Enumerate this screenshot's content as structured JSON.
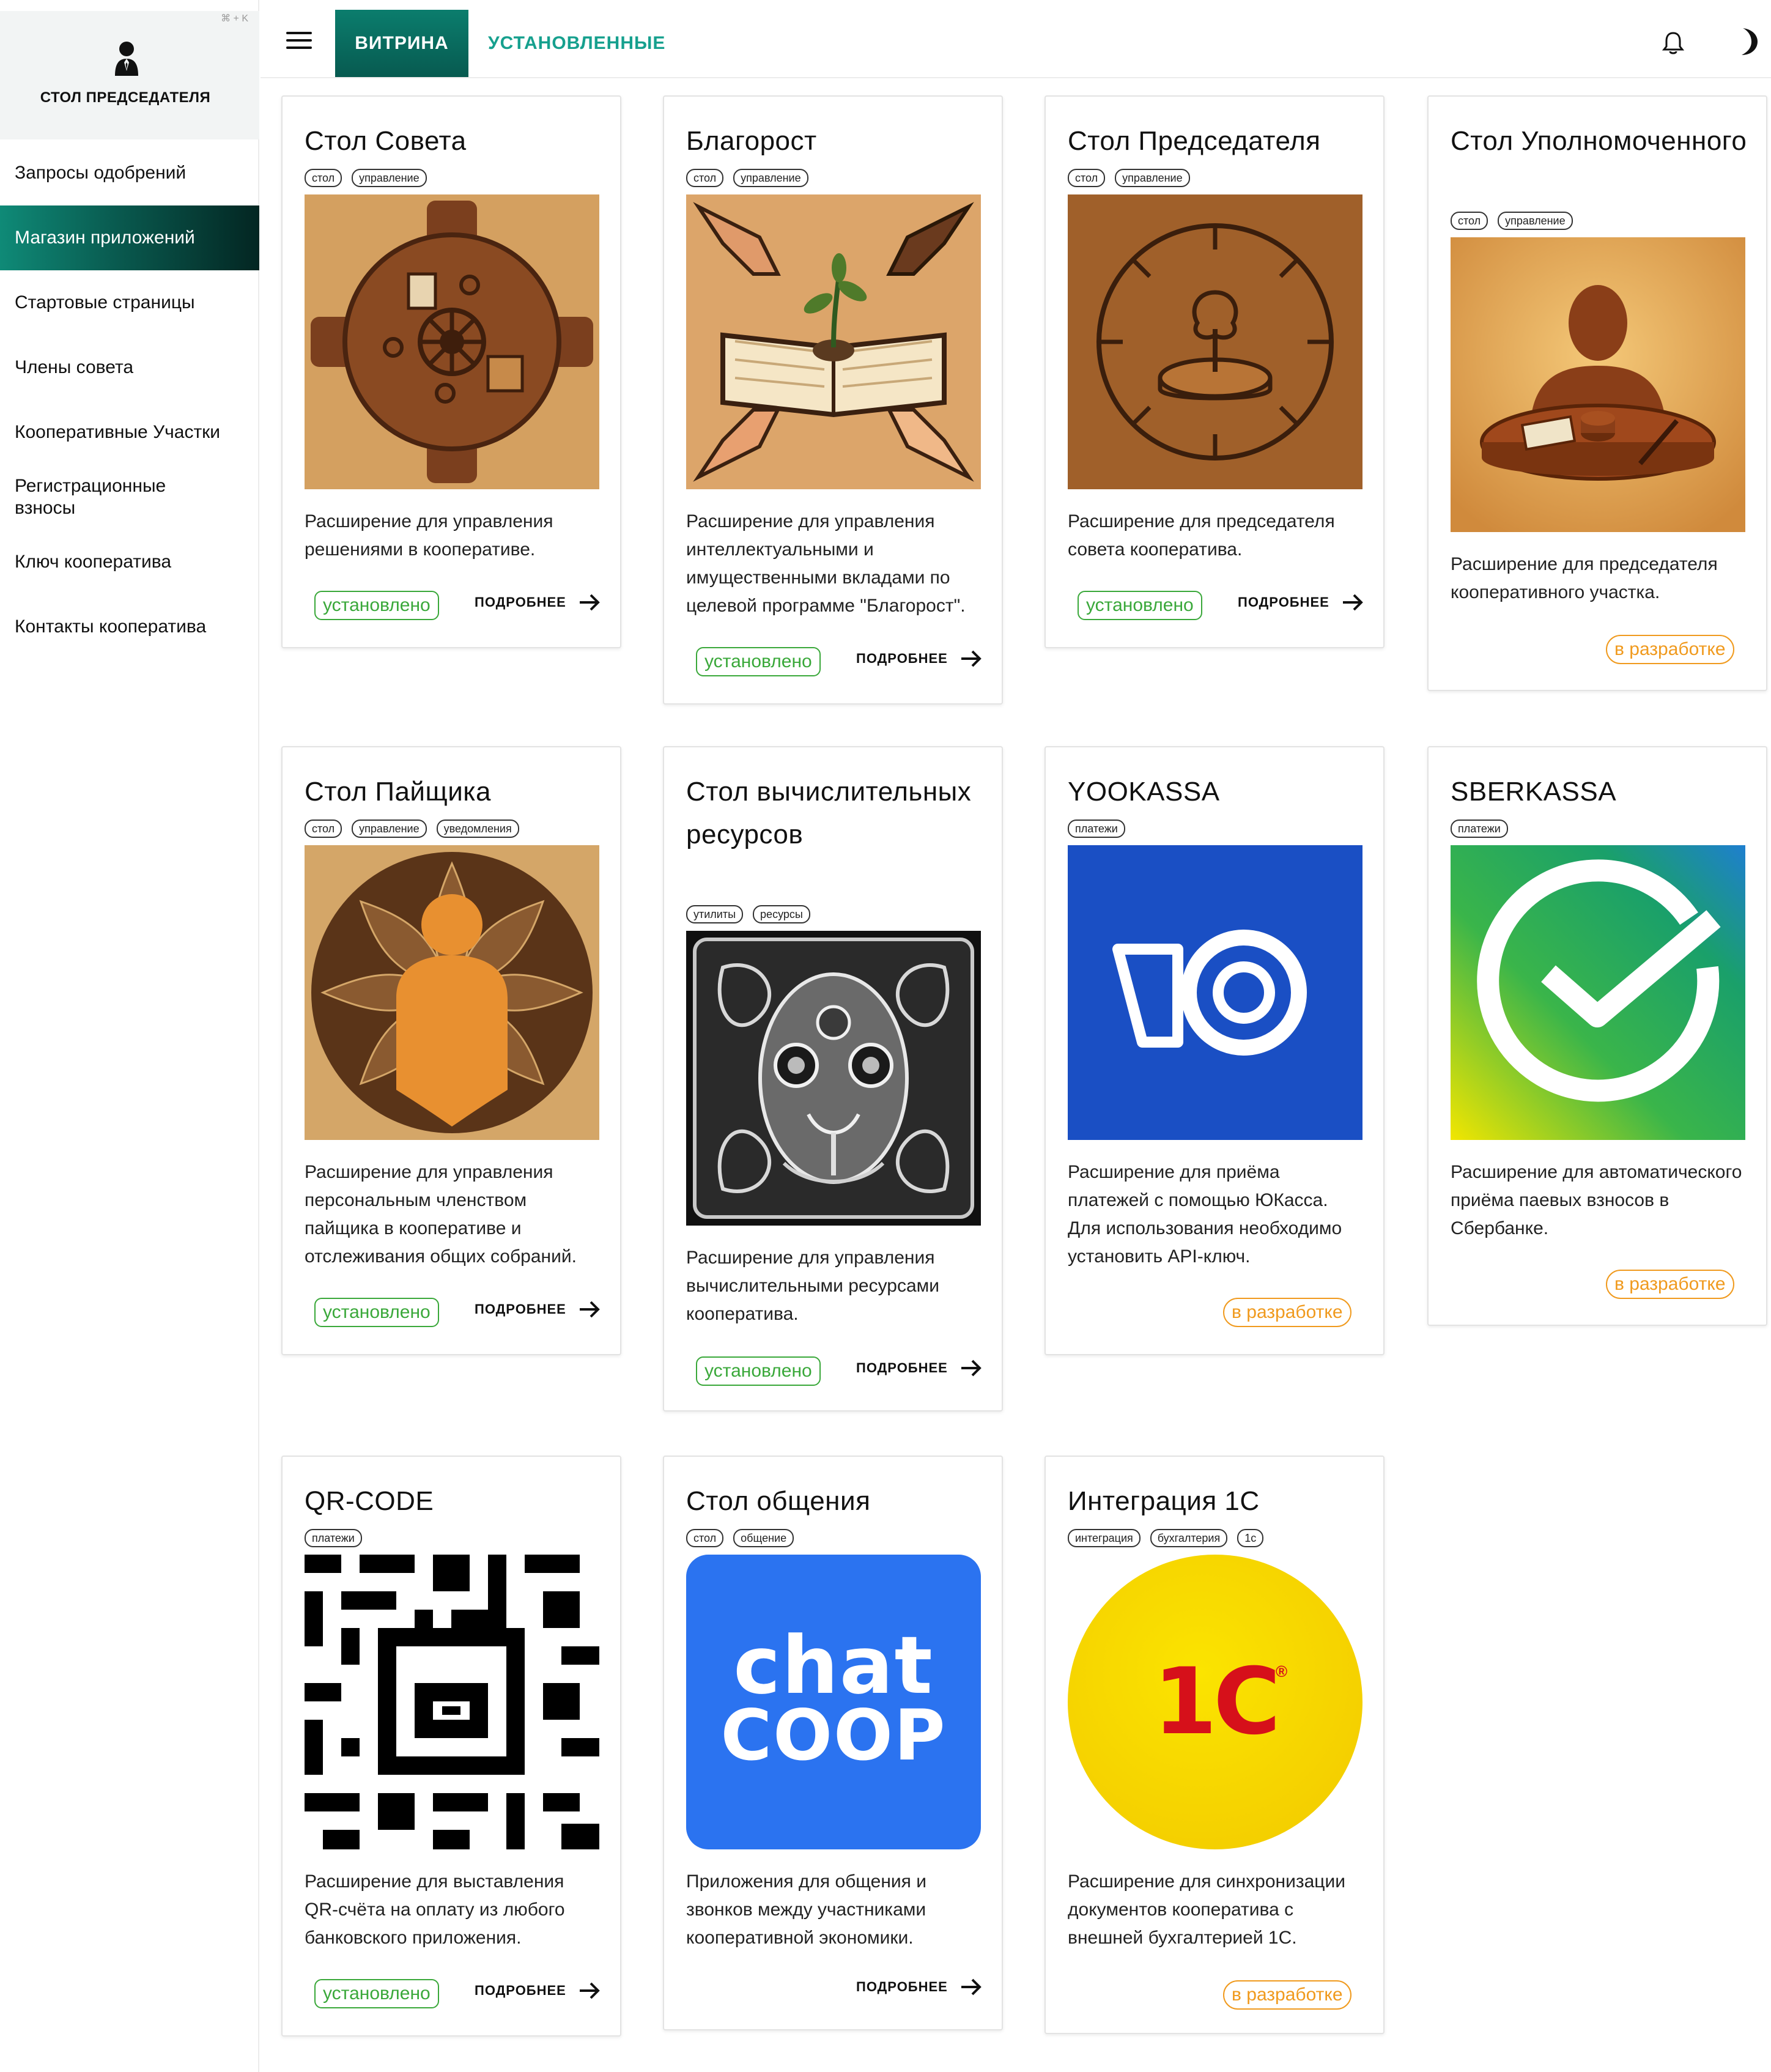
{
  "sidebar": {
    "shortcut": "⌘ + K",
    "title": "СТОЛ ПРЕДСЕДАТЕЛЯ",
    "items": [
      {
        "label": "Запросы одобрений"
      },
      {
        "label": "Магазин приложений"
      },
      {
        "label": "Стартовые страницы"
      },
      {
        "label": "Члены совета"
      },
      {
        "label": "Кооперативные Участки"
      },
      {
        "label": "Регистрационные взносы"
      },
      {
        "label": "Ключ кооператива"
      },
      {
        "label": "Контакты кооператива"
      }
    ]
  },
  "header": {
    "tabs": [
      {
        "label": "ВИТРИНА"
      },
      {
        "label": "УСТАНОВЛЕННЫЕ"
      }
    ]
  },
  "colors": {
    "accent": "#0b7d6d",
    "installed": "#3aa83a",
    "in_dev": "#f09a1e"
  },
  "more_label": "ПОДРОБНЕЕ",
  "cards": [
    {
      "title": "Стол Совета",
      "tags": [
        "стол",
        "управление"
      ],
      "description": "Расширение для управления решениями в кооперативе.",
      "status": "установлено"
    },
    {
      "title": "Благорост",
      "tags": [
        "стол",
        "управление"
      ],
      "description": "Расширение для управления интеллектуальными и имущественными вкладами по целевой программе \"Благорост\".",
      "status": "установлено"
    },
    {
      "title": "Стол Председателя",
      "tags": [
        "стол",
        "управление"
      ],
      "description": "Расширение для председателя совета кооператива.",
      "status": "установлено"
    },
    {
      "title": "Стол Уполномоченного",
      "tags": [
        "стол",
        "управление"
      ],
      "description": "Расширение для председателя кооперативного участка.",
      "status": "в разработке"
    },
    {
      "title": "Стол Пайщика",
      "tags": [
        "стол",
        "управление",
        "уведомления"
      ],
      "description": "Расширение для управления персональным членством пайщика в кооперативе и отслеживания общих собраний.",
      "status": "установлено"
    },
    {
      "title": "Стол вычислительных ресурсов",
      "tags": [
        "утилиты",
        "ресурсы"
      ],
      "description": "Расширение для управления вычислительными ресурсами кооператива.",
      "status": "установлено"
    },
    {
      "title": "YOOKASSA",
      "tags": [
        "платежи"
      ],
      "description": "Расширение для приёма платежей с помощью ЮКасса. Для использования необходимо установить API-ключ.",
      "status": "в разработке"
    },
    {
      "title": "SBERKASSA",
      "tags": [
        "платежи"
      ],
      "description": "Расширение для автоматического приёма паевых взносов в Сбербанке.",
      "status": "в разработке"
    },
    {
      "title": "QR-CODE",
      "tags": [
        "платежи"
      ],
      "description": "Расширение для выставления QR-счёта на оплату из любого банковского приложения.",
      "status": "установлено"
    },
    {
      "title": "Стол общения",
      "tags": [
        "стол",
        "общение"
      ],
      "description": "Приложения для общения и звонков между участниками кооперативной экономики.",
      "status": "",
      "logo_line1": "chat",
      "logo_line2": "COOP"
    },
    {
      "title": "Интеграция 1С",
      "tags": [
        "интеграция",
        "бухгалтерия",
        "1с"
      ],
      "description": "Расширение для синхронизации документов кооператива с внешней бухгалтерией 1С.",
      "status": "в разработке",
      "logo_text": "1С",
      "logo_mark": "®"
    }
  ]
}
